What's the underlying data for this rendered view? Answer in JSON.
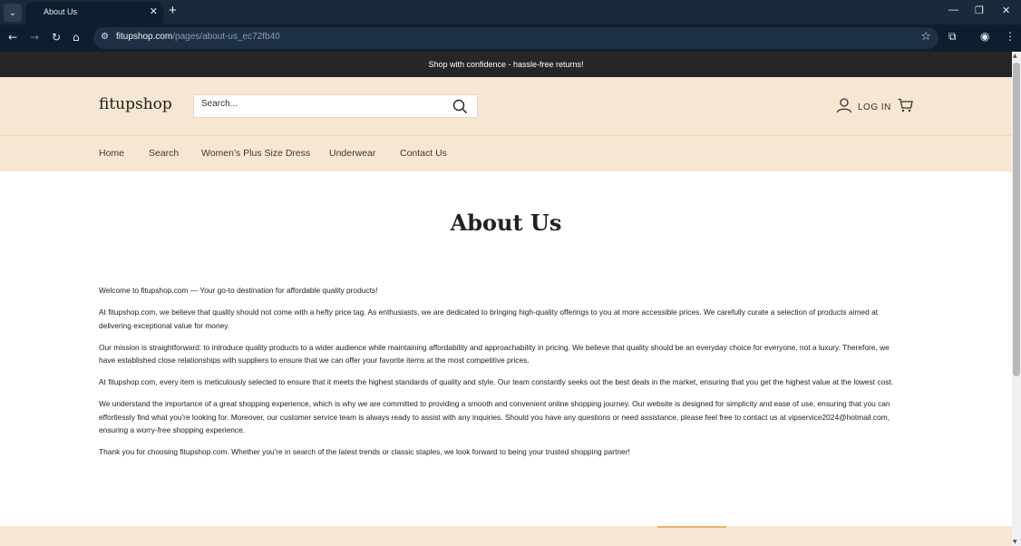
{
  "browser": {
    "tab_title": "About Us",
    "tab_close": "✕",
    "new_tab": "+",
    "url_host": "fitupshop.com",
    "url_path": "/pages/about-us_ec72fb40",
    "icons": [
      "tab-search-icon",
      "back-icon",
      "forward-icon",
      "reload-icon",
      "home-icon",
      "site-info-icon",
      "bookmark-star-icon",
      "extensions-icon",
      "profile-icon",
      "menu-icon",
      "minimize-icon",
      "restore-icon",
      "close-window-icon"
    ]
  },
  "announcement": "Shop with confidence - hassle-free returns!",
  "header": {
    "logo": "fitupshop",
    "search_placeholder": "Search...",
    "login_label": "LOG IN"
  },
  "nav": {
    "items": [
      "Home",
      "Search",
      "Women's Plus Size Dress",
      "Underwear",
      "Contact Us"
    ]
  },
  "page": {
    "title": "About Us",
    "paragraphs": [
      "Welcome to fitupshop.com — Your go-to destination for affordable quality products!",
      "At fitupshop.com, we believe that quality should not come with a hefty price tag. As enthusiasts, we are dedicated to bringing high-quality offerings to you at more accessible prices. We carefully curate a selection of products aimed at delivering exceptional value for money.",
      "Our mission is straightforward: to introduce quality products to a wider audience while maintaining affordability and approachability in pricing. We believe that quality should be an everyday choice for everyone, not a luxury. Therefore, we have established close relationships with suppliers to ensure that we can offer your favorite items at the most competitive prices.",
      "At fitupshop.com, every item is meticulously selected to ensure that it meets the highest standards of quality and style. Our team constantly seeks out the best deals in the market, ensuring that you get the highest value at the lowest cost.",
      "We understand the importance of a great shopping experience, which is why we are committed to providing a smooth and convenient online shopping journey. Our website is designed for simplicity and ease of use, ensuring that you can effortlessly find what you're looking for. Moreover, our customer service team is always ready to assist with any inquiries. Should you have any questions or need assistance, please feel free to contact us at vipservice2024@hotmail.com, ensuring a worry-free shopping experience.",
      "Thank you for choosing fitupshop.com. Whether you're in search of the latest trends or classic staples, we look forward to being your trusted shopping partner!"
    ]
  },
  "colors": {
    "header_bg": "#f7e6d1",
    "announcement_bg": "#262626",
    "browser_bg": "#0d1e2f",
    "footer_accent": "#e9b26a"
  }
}
